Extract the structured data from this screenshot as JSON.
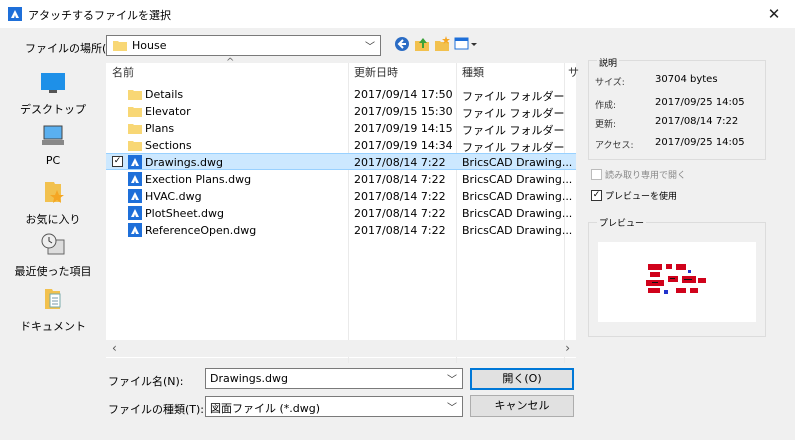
{
  "window": {
    "title": "アタッチするファイルを選択",
    "close_glyph": "✕"
  },
  "location": {
    "label": "ファイルの場所(I):",
    "value": "House"
  },
  "places": [
    {
      "label": "デスクトップ"
    },
    {
      "label": "PC"
    },
    {
      "label": "お気に入り"
    },
    {
      "label": "最近使った項目"
    },
    {
      "label": "ドキュメント"
    }
  ],
  "columns": {
    "name": "名前",
    "modified": "更新日時",
    "type": "種類",
    "size": "サ"
  },
  "files": [
    {
      "name": "Details",
      "date": "2017/09/14 17:50",
      "type": "ファイル フォルダー",
      "kind": "folder"
    },
    {
      "name": "Elevator",
      "date": "2017/09/15 15:30",
      "type": "ファイル フォルダー",
      "kind": "folder"
    },
    {
      "name": "Plans",
      "date": "2017/09/19 14:15",
      "type": "ファイル フォルダー",
      "kind": "folder"
    },
    {
      "name": "Sections",
      "date": "2017/09/19 14:34",
      "type": "ファイル フォルダー",
      "kind": "folder"
    },
    {
      "name": "Drawings.dwg",
      "date": "2017/08/14 7:22",
      "type": "BricsCAD Drawing...",
      "kind": "dwg",
      "selected": true
    },
    {
      "name": "Exection Plans.dwg",
      "date": "2017/08/14 7:22",
      "type": "BricsCAD Drawing...",
      "kind": "dwg"
    },
    {
      "name": "HVAC.dwg",
      "date": "2017/08/14 7:22",
      "type": "BricsCAD Drawing...",
      "kind": "dwg"
    },
    {
      "name": "PlotSheet.dwg",
      "date": "2017/08/14 7:22",
      "type": "BricsCAD Drawing...",
      "kind": "dwg"
    },
    {
      "name": "ReferenceOpen.dwg",
      "date": "2017/08/14 7:22",
      "type": "BricsCAD Drawing...",
      "kind": "dwg"
    }
  ],
  "filename": {
    "label": "ファイル名(N):",
    "value": "Drawings.dwg"
  },
  "filetype": {
    "label": "ファイルの種類(T):",
    "value": "図面ファイル (*.dwg)"
  },
  "buttons": {
    "open": "開く(O)",
    "cancel": "キャンセル"
  },
  "info": {
    "title": "説明",
    "size_label": "サイズ:",
    "size_value": "30704 bytes",
    "created_label": "作成:",
    "created_value": "2017/09/25 14:05",
    "updated_label": "更新:",
    "updated_value": "2017/08/14 7:22",
    "access_label": "アクセス:",
    "access_value": "2017/09/25 14:05"
  },
  "options": {
    "readonly_label": "読み取り専用で開く",
    "readonly_checked": false,
    "preview_label": "プレビューを使用",
    "preview_checked": true
  },
  "preview": {
    "title": "プレビュー"
  },
  "colors": {
    "accent": "#0078d7",
    "selection": "#cce8ff",
    "folder": "#f8d775",
    "dwg_icon": "#1e6fd9"
  }
}
